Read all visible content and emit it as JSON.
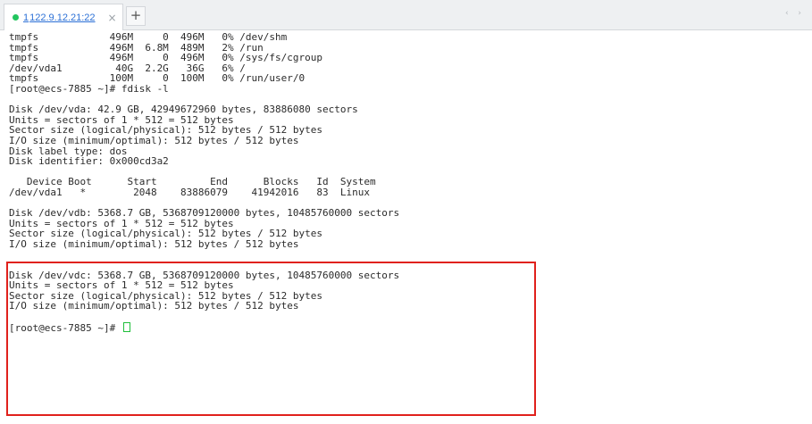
{
  "colors": {
    "tab_status": "#22c55e",
    "highlight_box": "#e0211c",
    "cursor": "#1fbf3a",
    "link": "#2a6fd6"
  },
  "tabs": [
    {
      "index": "1",
      "label": "122.9.12.21:22",
      "close_icon": "×",
      "status": "connected"
    }
  ],
  "tabbar": {
    "add_icon": "+",
    "nav_icons": "‹ ›"
  },
  "terminal": {
    "lines": [
      "tmpfs            496M     0  496M   0% /dev/shm",
      "tmpfs            496M  6.8M  489M   2% /run",
      "tmpfs            496M     0  496M   0% /sys/fs/cgroup",
      "/dev/vda1         40G  2.2G   36G   6% /",
      "tmpfs            100M     0  100M   0% /run/user/0",
      "[root@ecs-7885 ~]# fdisk -l",
      "",
      "Disk /dev/vda: 42.9 GB, 42949672960 bytes, 83886080 sectors",
      "Units = sectors of 1 * 512 = 512 bytes",
      "Sector size (logical/physical): 512 bytes / 512 bytes",
      "I/O size (minimum/optimal): 512 bytes / 512 bytes",
      "Disk label type: dos",
      "Disk identifier: 0x000cd3a2",
      "",
      "   Device Boot      Start         End      Blocks   Id  System",
      "/dev/vda1   *        2048    83886079    41942016   83  Linux",
      "",
      "Disk /dev/vdb: 5368.7 GB, 5368709120000 bytes, 10485760000 sectors",
      "Units = sectors of 1 * 512 = 512 bytes",
      "Sector size (logical/physical): 512 bytes / 512 bytes",
      "I/O size (minimum/optimal): 512 bytes / 512 bytes",
      "",
      "",
      "Disk /dev/vdc: 5368.7 GB, 5368709120000 bytes, 10485760000 sectors",
      "Units = sectors of 1 * 512 = 512 bytes",
      "Sector size (logical/physical): 512 bytes / 512 bytes",
      "I/O size (minimum/optimal): 512 bytes / 512 bytes",
      "",
      "[root@ecs-7885 ~]# "
    ]
  }
}
